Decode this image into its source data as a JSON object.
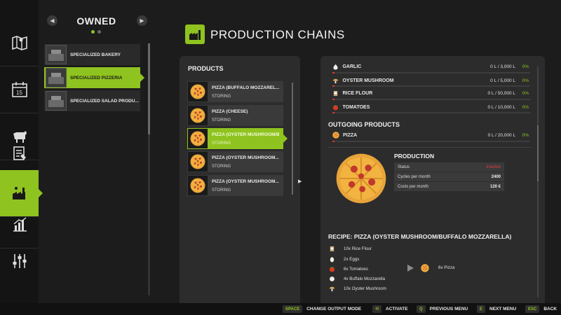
{
  "owned": {
    "title": "OWNED",
    "prev_icon": "chevron-left-icon",
    "next_icon": "chevron-right-icon",
    "productions": [
      {
        "label": "SPECIALIZED BAKERY",
        "selected": false
      },
      {
        "label": "SPECIALIZED PIZZERIA",
        "selected": true
      },
      {
        "label": "SPECIALIZED SALAD PRODU...",
        "selected": false
      }
    ]
  },
  "nav": [
    {
      "icon": "map-icon",
      "active": false
    },
    {
      "icon": "calendar-icon",
      "active": false
    },
    {
      "icon": "cow-icon",
      "active": false
    },
    {
      "icon": "contracts-icon",
      "active": false
    },
    {
      "icon": "production-icon",
      "active": true
    },
    {
      "icon": "statistics-icon",
      "active": false
    },
    {
      "icon": "settings-icon",
      "active": false
    }
  ],
  "header": {
    "title": "PRODUCTION CHAINS",
    "icon": "factory-icon"
  },
  "products": {
    "heading": "PRODUCTS",
    "items": [
      {
        "name": "PIZZA (BUFFALO MOZZAREL...",
        "status": "STORING",
        "selected": false
      },
      {
        "name": "PIZZA (CHEESE)",
        "status": "STORING",
        "selected": false
      },
      {
        "name": "PIZZA (OYSTER MUSHROOM/B",
        "status": "STORING",
        "selected": true
      },
      {
        "name": "PIZZA (OYSTER MUSHROOM...",
        "status": "STORING",
        "selected": false
      },
      {
        "name": "PIZZA (OYSTER MUSHROOM...",
        "status": "STORING",
        "selected": false
      }
    ]
  },
  "inputs": [
    {
      "name": "GARLIC",
      "amount": "0 L / 3,000 L",
      "pct": "0%",
      "icon": "garlic-icon"
    },
    {
      "name": "OYSTER MUSHROOM",
      "amount": "0 L / 5,000 L",
      "pct": "0%",
      "icon": "mushroom-icon"
    },
    {
      "name": "RICE FLOUR",
      "amount": "0 L / 50,000 L",
      "pct": "0%",
      "icon": "flour-icon"
    },
    {
      "name": "TOMATOES",
      "amount": "0 L / 10,000 L",
      "pct": "0%",
      "icon": "tomato-icon"
    }
  ],
  "outgoing": {
    "heading": "OUTGOING PRODUCTS",
    "items": [
      {
        "name": "PIZZA",
        "amount": "0 L / 20,000 L",
        "pct": "0%",
        "icon": "pizza-icon"
      }
    ]
  },
  "production": {
    "heading": "PRODUCTION",
    "status_label": "Status",
    "status_value": "Inactive",
    "cycles_label": "Cycles per month",
    "cycles_value": "2400",
    "costs_label": "Costs per month",
    "costs_value": "120 €"
  },
  "recipe": {
    "title": "RECIPE: PIZZA (OYSTER MUSHROOM/BUFFALO MOZZARELLA)",
    "inputs": [
      {
        "text": "10x Rice Flour",
        "icon": "flour-icon"
      },
      {
        "text": "2x Eggs",
        "icon": "egg-icon"
      },
      {
        "text": "6x Tomatoes",
        "icon": "tomato-icon"
      },
      {
        "text": "4x Buffalo Mozzarella",
        "icon": "mozzarella-icon"
      },
      {
        "text": "10x Oyster Mushroom",
        "icon": "mushroom-icon"
      }
    ],
    "output": "6x Pizza"
  },
  "keys": [
    {
      "key": "SPACE",
      "label": "CHANGE OUTPUT MODE"
    },
    {
      "key": "⟲",
      "label": "ACTIVATE"
    },
    {
      "key": "Q",
      "label": "PREVIOUS MENU"
    },
    {
      "key": "E",
      "label": "NEXT MENU"
    },
    {
      "key": "ESC",
      "label": "BACK"
    }
  ],
  "colors": {
    "accent": "#8fc31f",
    "panel": "#2c2c2c",
    "inactive": "#e03a3a"
  }
}
